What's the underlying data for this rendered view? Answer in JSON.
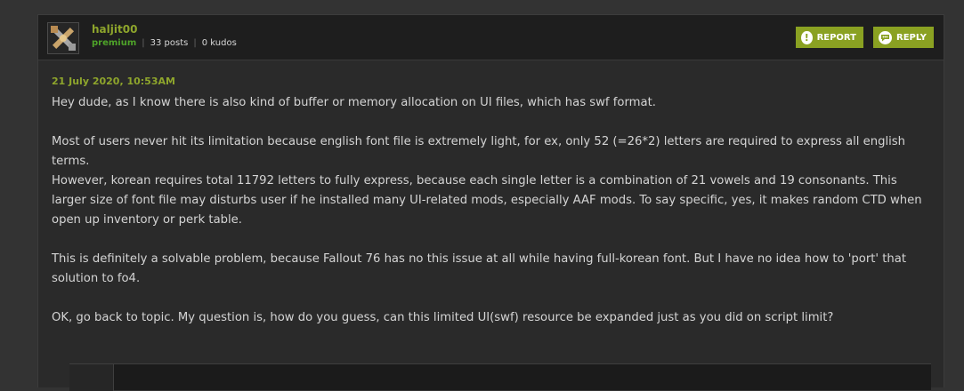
{
  "post": {
    "author": {
      "username": "haljit00",
      "rank": "premium",
      "posts": "33 posts",
      "kudos": "0 kudos"
    },
    "actions": {
      "report_label": "REPORT",
      "reply_label": "REPLY"
    },
    "date": "21 July 2020, 10:53AM",
    "paragraphs": [
      "Hey dude, as I know there is also kind of buffer or memory allocation on UI files, which has swf format.",
      "Most of users never hit its limitation because english font file is extremely light, for ex, only 52 (=26*2) letters are required to express all english terms.",
      "However, korean requires total 11792 letters to fully express, because each single letter is a combination of 21 vowels and 19 consonants. This larger size of font file may disturbs user if he installed many UI-related mods, especially AAF mods. To say specific, yes, it makes random CTD when open up inventory or perk table.",
      "This is definitely a solvable problem, because Fallout 76 has no this issue at all while having full-korean font. But I have no idea how to 'port' that solution to fo4.",
      "OK, go back to topic. My question is, how do you guess, can this limited UI(swf) resource be expanded just as you did on script limit?"
    ]
  },
  "colors": {
    "accent": "#8aa122",
    "username": "#8ea52c",
    "rank": "#4ea329",
    "background": "#333333",
    "panel": "#2a2a2a",
    "header": "#1e1e1e",
    "text": "#d4d4d4"
  },
  "icons": {
    "avatar": "crossed-shapes-avatar",
    "report": "exclamation-circle-icon",
    "reply": "speech-bubble-icon"
  }
}
